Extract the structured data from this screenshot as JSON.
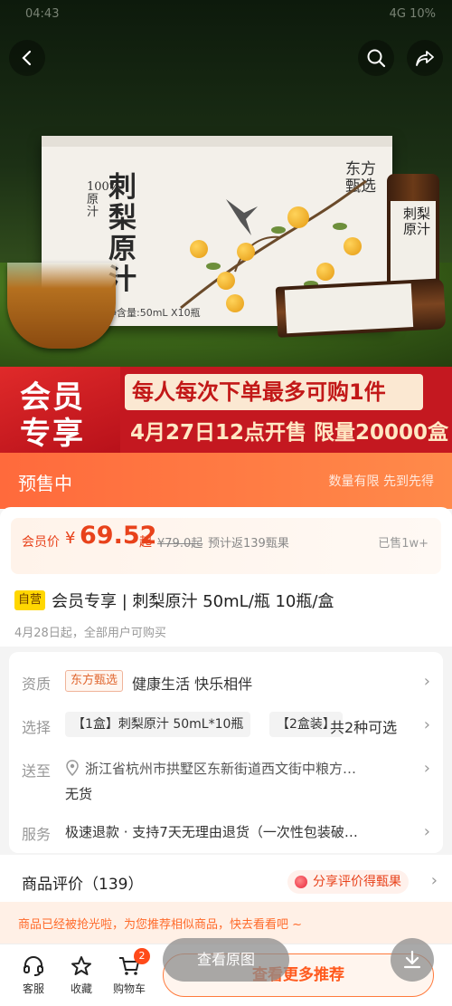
{
  "status_bar": {
    "time": "04:43",
    "right": "4G 10%"
  },
  "hero": {
    "box_title": "刺梨原汁",
    "box_tag": "100% 原汁",
    "box_brand": "东方甄选",
    "box_spec": "净含量:50mL X10瓶",
    "bottle_label": "刺梨原汁"
  },
  "banner": {
    "badge_line1": "会员",
    "badge_line2": "专享",
    "line1": "每人每次下单最多可购1件",
    "line2": "4月27日12点开售 限量20000盒"
  },
  "presale": {
    "title": "预售中",
    "note": "数量有限 先到先得"
  },
  "price": {
    "label": "会员价",
    "currency": "¥",
    "value": "69.52",
    "suffix": "起",
    "original": "¥79.0起",
    "rebate": "预计返139甄果",
    "sold": "已售1w+"
  },
  "product": {
    "badge": "自营",
    "title": "会员专享 | 刺梨原汁 50mL/瓶 10瓶/盒",
    "date_note": "4月28日起，全部用户可购买"
  },
  "info": {
    "qualification": {
      "label": "资质",
      "tag": "东方甄选",
      "value": "健康生活 快乐相伴"
    },
    "select": {
      "label": "选择",
      "option1": "【1盒】刺梨原汁 50mL*10瓶",
      "option2": "【2盒装】",
      "summary": "共2种可选"
    },
    "delivery": {
      "label": "送至",
      "address": "浙江省杭州市拱墅区东新街道西文街中粮方…",
      "stock": "无货"
    },
    "service": {
      "label": "服务",
      "value": "极速退款 · 支持7天无理由退货（一次性包装破…"
    }
  },
  "reviews": {
    "title": "商品评价（139）",
    "share": "分享评价得甄果"
  },
  "notice": {
    "text": "商品已经被抢光啦，为您推荐相似商品，快去看看吧 ~"
  },
  "bottom": {
    "service_label": "客服",
    "favorite_label": "收藏",
    "cart_label": "购物车",
    "cart_count": "2",
    "cta": "查看更多推荐",
    "view_original": "查看原图"
  },
  "colors": {
    "accent": "#e8421b",
    "banner_red": "#c41820",
    "presale_orange": "#ff7a40"
  }
}
